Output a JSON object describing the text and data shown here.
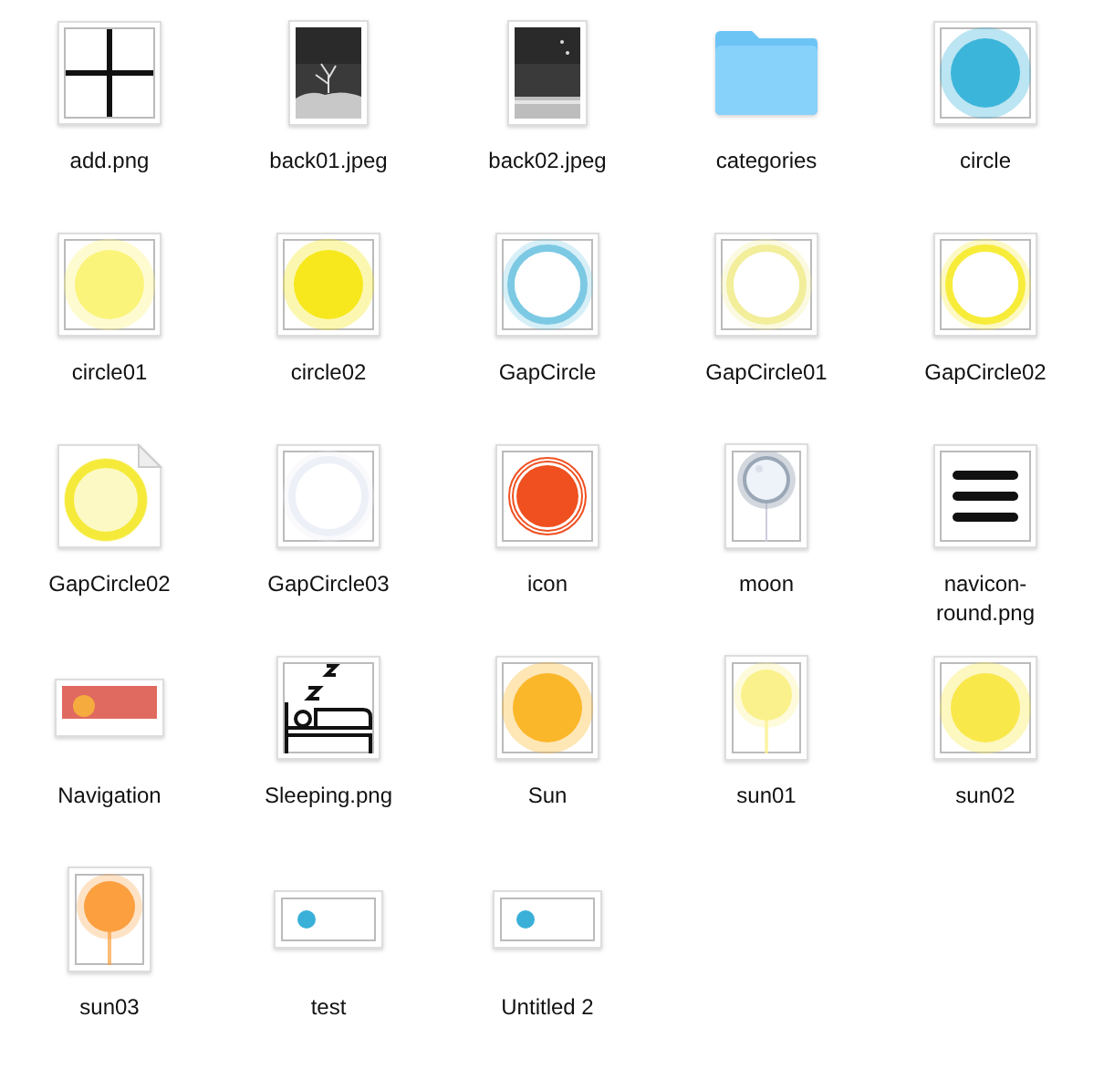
{
  "files": [
    {
      "name": "add.png",
      "kind": "cross"
    },
    {
      "name": "back01.jpeg",
      "kind": "photo-tree"
    },
    {
      "name": "back02.jpeg",
      "kind": "photo-sea"
    },
    {
      "name": "categories",
      "kind": "folder"
    },
    {
      "name": "circle",
      "kind": "glow-circle",
      "color": "#3cb5da"
    },
    {
      "name": "circle01",
      "kind": "glow-circle",
      "color": "#fbf47a"
    },
    {
      "name": "circle02",
      "kind": "glow-circle",
      "color": "#f6e81d"
    },
    {
      "name": "GapCircle",
      "kind": "ring",
      "color": "#7cc9e4"
    },
    {
      "name": "GapCircle01",
      "kind": "ring",
      "color": "#f2ee9a"
    },
    {
      "name": "GapCircle02",
      "kind": "ring",
      "color": "#f7ec3a"
    },
    {
      "name": "GapCircle02",
      "kind": "ring-page",
      "color": "#f5ea3a"
    },
    {
      "name": "GapCircle03",
      "kind": "ring",
      "color": "#eef0f8"
    },
    {
      "name": "icon",
      "kind": "target",
      "color": "#f04f1f"
    },
    {
      "name": "moon",
      "kind": "moon"
    },
    {
      "name": "navicon-round.png",
      "kind": "menu"
    },
    {
      "name": "Navigation",
      "kind": "banner"
    },
    {
      "name": "Sleeping.png",
      "kind": "sleeping"
    },
    {
      "name": "Sun",
      "kind": "glow-circle",
      "color": "#fbb72a"
    },
    {
      "name": "sun01",
      "kind": "lollipop",
      "color": "#fbf18c"
    },
    {
      "name": "sun02",
      "kind": "glow-circle",
      "color": "#f9e84a"
    },
    {
      "name": "sun03",
      "kind": "lollipop",
      "color": "#fb9f3f"
    },
    {
      "name": "test",
      "kind": "wide-dot",
      "color": "#3ab0d8"
    },
    {
      "name": "Untitled 2",
      "kind": "wide-dot",
      "color": "#3ab0d8"
    }
  ]
}
